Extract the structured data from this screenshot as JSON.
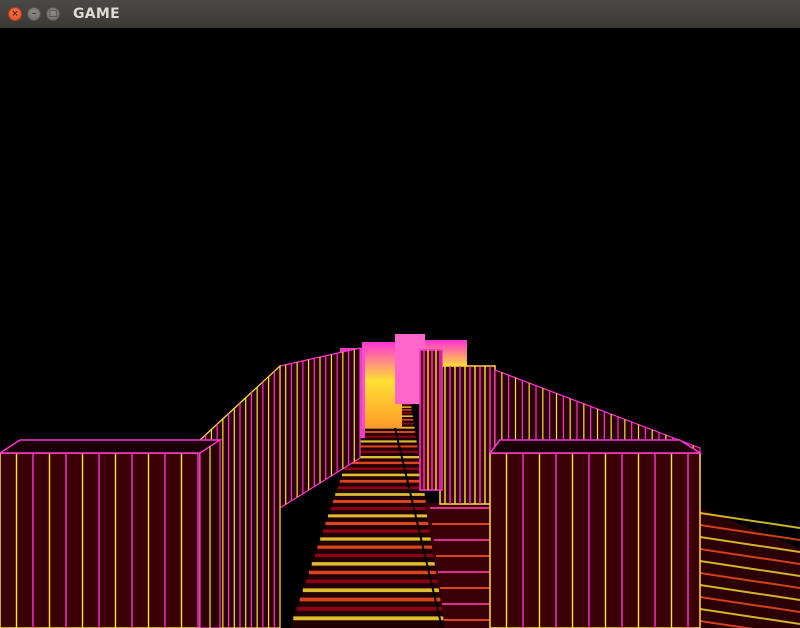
{
  "window": {
    "title": "GAME",
    "close_glyph": "×",
    "minimize_glyph": "–",
    "maximize_glyph": "□"
  },
  "scene": {
    "background": "#000000",
    "colors": {
      "edge_yellow": "#ffe033",
      "edge_magenta": "#ff33d6",
      "edge_orange": "#ff9a2a",
      "fill_dark_red": "#3a0006",
      "fill_red": "#a0001a",
      "floor_glow": "#ff5020"
    }
  }
}
